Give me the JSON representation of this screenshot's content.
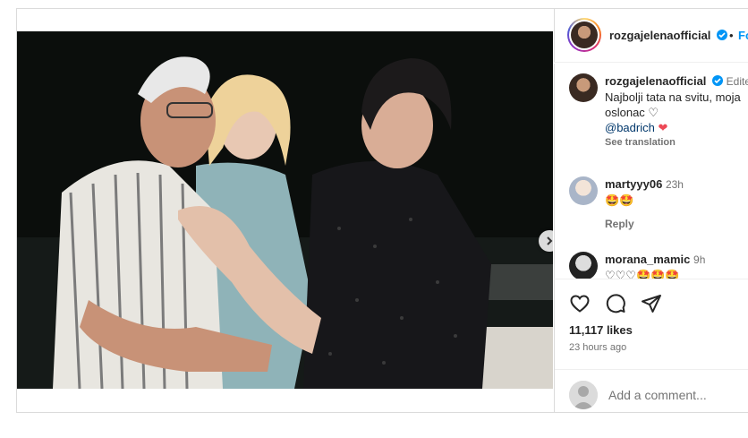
{
  "post": {
    "username": "rozgajelenaofficial",
    "verified": true,
    "separator": "•",
    "follow_label": "Fo",
    "edited_label": "Edite"
  },
  "caption": {
    "username": "rozgajelenaofficial",
    "line1": "Najbolji tata na svitu, moja",
    "line2": "oslonac ♡",
    "mention": "@badrich",
    "heart": "❤",
    "see_translation": "See translation"
  },
  "comments": [
    {
      "username": "martyyy06",
      "time": "23h",
      "text": "🤩🤩",
      "reply_label": "Reply"
    },
    {
      "username": "morana_mamic",
      "time": "9h",
      "text": "♡♡♡🤩🤩🤩"
    }
  ],
  "actions": {
    "likes": "11,117 likes",
    "time_ago": "23 hours ago"
  },
  "add_comment": {
    "placeholder": "Add a comment..."
  },
  "carousel": {
    "total": 2,
    "active": 1
  },
  "colors": {
    "accent": "#0095f6",
    "verified": "#0095f6",
    "heart": "#ed4956",
    "muted": "#737373",
    "border": "#dbdbdb"
  },
  "icons": [
    "like-icon",
    "comment-icon",
    "share-icon",
    "next-icon",
    "verified-icon"
  ]
}
